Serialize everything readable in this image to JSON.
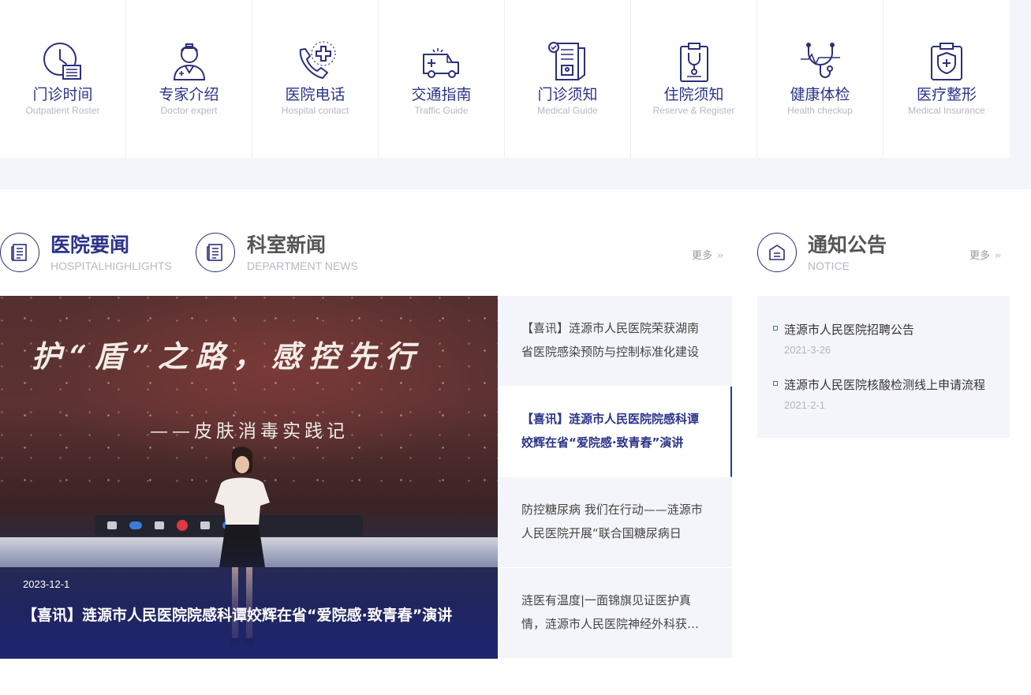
{
  "services": [
    {
      "cn": "门诊时间",
      "en": "Outpatient Roster",
      "icon": "clock-schedule-icon"
    },
    {
      "cn": "专家介绍",
      "en": "Doctor expert",
      "icon": "doctor-icon"
    },
    {
      "cn": "医院电话",
      "en": "Hospital contact",
      "icon": "phone-cross-icon"
    },
    {
      "cn": "交通指南",
      "en": "Traffic Guide",
      "icon": "ambulance-icon"
    },
    {
      "cn": "门诊须知",
      "en": "Medical Guide",
      "icon": "medical-document-icon"
    },
    {
      "cn": "住院须知",
      "en": "Reserve & Register",
      "icon": "clipboard-stethoscope-icon"
    },
    {
      "cn": "健康体检",
      "en": "Health checkup",
      "icon": "stethoscope-icon"
    },
    {
      "cn": "医疗整形",
      "en": "Medical Insurance",
      "icon": "shield-clipboard-icon"
    }
  ],
  "sections": {
    "highlights": {
      "cn": "医院要闻",
      "en": "HOSPITALHIGHLIGHTS"
    },
    "department": {
      "cn": "科室新闻",
      "en": "DEPARTMENT NEWS"
    },
    "news_more": "更多",
    "notice": {
      "cn": "通知公告",
      "en": "NOTICE"
    },
    "notice_more": "更多"
  },
  "feature": {
    "slogan": "护“盾”之路，感控先行",
    "subtitle": "——皮肤消毒实践记",
    "date": "2023-12-1",
    "title": "【喜讯】涟源市人民医院院感科谭姣辉在省“爱院感·致青春”演讲"
  },
  "news": [
    {
      "title": "【喜讯】涟源市人民医院荣获湖南省医院感染预防与控制标准化建设"
    },
    {
      "title": "【喜讯】涟源市人民医院院感科谭姣辉在省“爱院感·致青春”演讲"
    },
    {
      "title": "防控糖尿病 我们在行动——涟源市人民医院开展“联合国糖尿病日"
    },
    {
      "title": "涟医有温度|一面锦旗见证医护真情，涟源市人民医院神经外科获赠锦旗"
    }
  ],
  "notices": [
    {
      "title": "涟源市人民医院招聘公告",
      "date": "2021-3-26"
    },
    {
      "title": "涟源市人民医院核酸检测线上申请流程",
      "date": "2021-2-1"
    }
  ],
  "colors": {
    "brand": "#2c3389",
    "accent_line": "#1d3f8f",
    "panel_bg": "#f4f5fa"
  }
}
